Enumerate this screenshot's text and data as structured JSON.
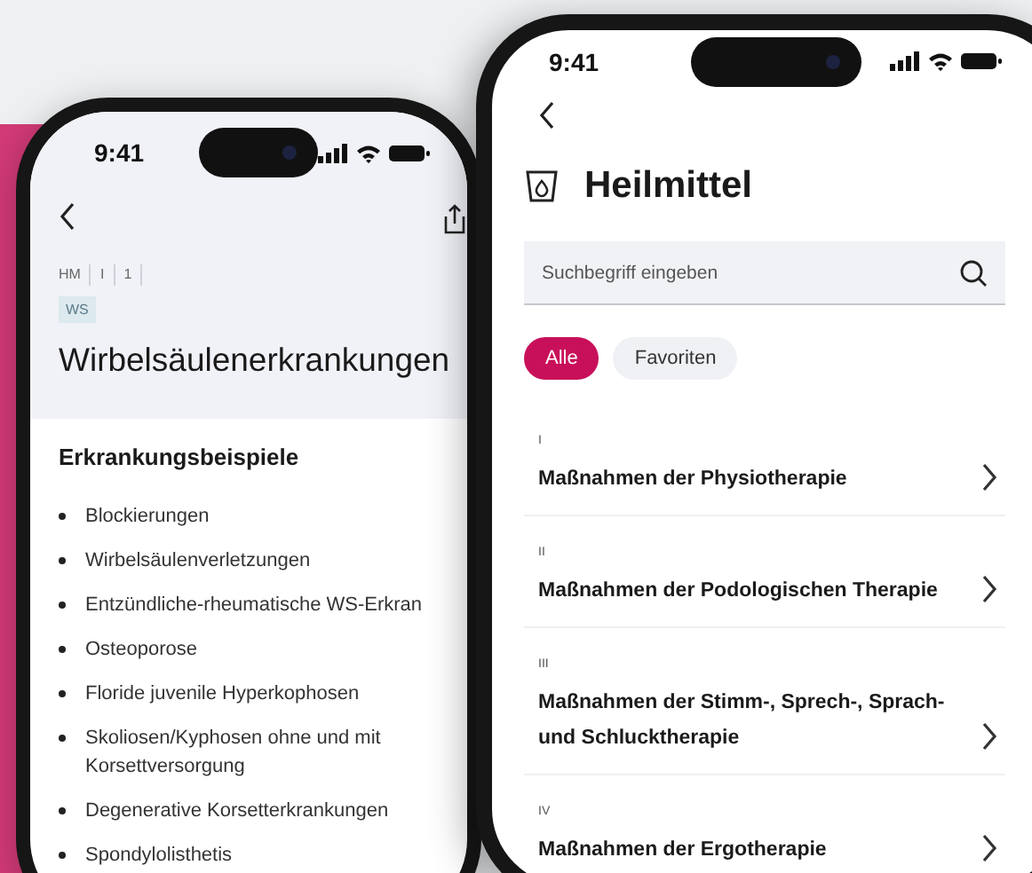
{
  "back_phone": {
    "status_bar": {
      "time": "9:41"
    },
    "breadcrumb": [
      "HM",
      "I",
      "1"
    ],
    "tag": "WS",
    "title": "Wirbelsäulenerkrankungen",
    "section_heading": "Erkrankungsbeispiele",
    "items": [
      "Blockierungen",
      "Wirbelsäulenverletzungen",
      "Entzündliche-rheumatische WS-Erkran",
      "Osteoporose",
      "Floride juvenile Hyperkophosen",
      "Skoliosen/Kyphosen ohne und mit Korsettversorgung",
      "Degenerative Korsetterkrankungen",
      "Spondylolisthetis"
    ]
  },
  "front_phone": {
    "status_bar": {
      "time": "9:41"
    },
    "title": "Heilmittel",
    "search": {
      "placeholder": "Suchbegriff eingeben"
    },
    "filters": [
      {
        "label": "Alle",
        "selected": true
      },
      {
        "label": "Favoriten",
        "selected": false
      }
    ],
    "categories": [
      {
        "number": "I",
        "title": "Maßnahmen der Physiotherapie"
      },
      {
        "number": "II",
        "title": "Maßnahmen der Podologischen Therapie"
      },
      {
        "number": "III",
        "title": "Maßnahmen der Stimm-, Sprech-, Sprach- und Schlucktherapie"
      },
      {
        "number": "IV",
        "title": "Maßnahmen der Ergotherapie"
      }
    ]
  }
}
